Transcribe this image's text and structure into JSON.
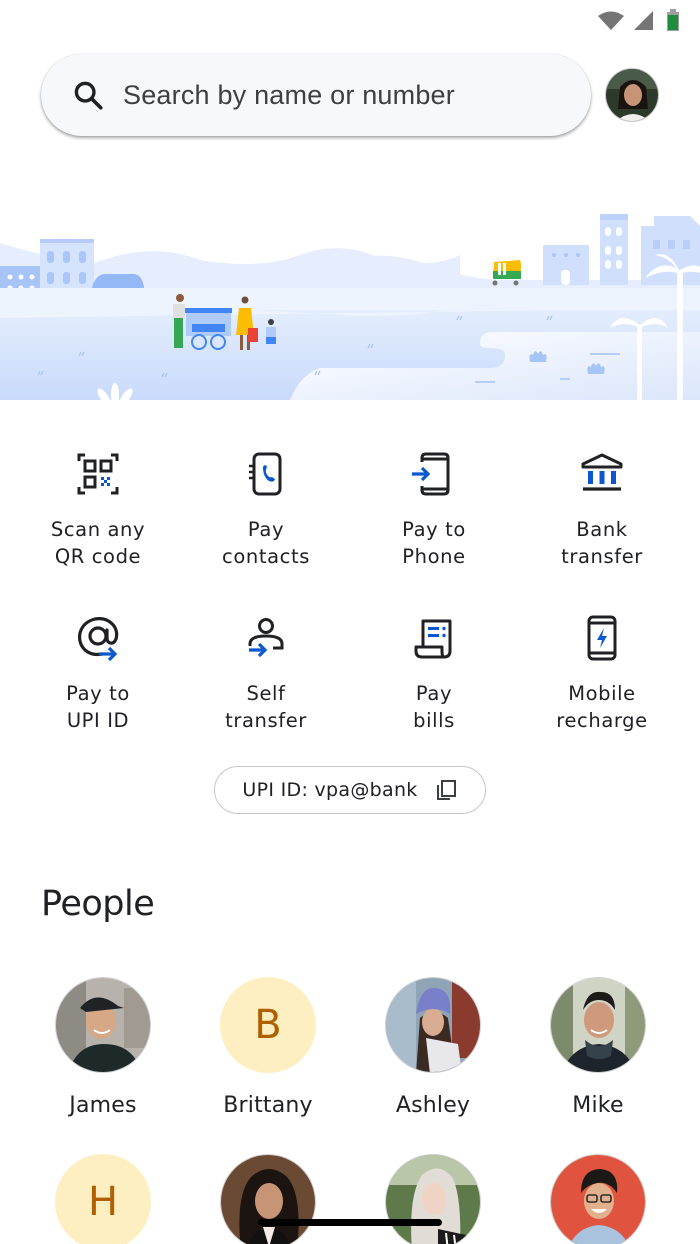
{
  "status_bar": {
    "icons": [
      "wifi-icon",
      "cell-signal-icon",
      "battery-icon"
    ],
    "battery_color": "#1e8e3e"
  },
  "search": {
    "placeholder": "Search by name or number",
    "icon": "search-icon"
  },
  "account": {
    "avatar": "profile-photo"
  },
  "hero": {
    "illustration": "city-street-scene-banner"
  },
  "actions": [
    {
      "label": "Scan any\nQR code",
      "icon": "qr-scan-icon"
    },
    {
      "label": "Pay\ncontacts",
      "icon": "contacts-book-icon"
    },
    {
      "label": "Pay to\nPhone",
      "icon": "phone-arrow-icon"
    },
    {
      "label": "Bank\ntransfer",
      "icon": "bank-icon"
    },
    {
      "label": "Pay to\nUPI ID",
      "icon": "at-arrow-icon"
    },
    {
      "label": "Self\ntransfer",
      "icon": "self-transfer-icon"
    },
    {
      "label": "Pay\nbills",
      "icon": "bill-receipt-icon"
    },
    {
      "label": "Mobile\nrecharge",
      "icon": "mobile-recharge-icon"
    }
  ],
  "upi": {
    "label": "UPI ID: vpa@bank",
    "icon": "copy-icon"
  },
  "people": {
    "title": "People",
    "items": [
      {
        "name": "James",
        "initial": "",
        "type": "photo"
      },
      {
        "name": "Brittany",
        "initial": "B",
        "type": "letter"
      },
      {
        "name": "Ashley",
        "initial": "",
        "type": "photo"
      },
      {
        "name": "Mike",
        "initial": "",
        "type": "photo"
      },
      {
        "name": "",
        "initial": "H",
        "type": "letter"
      },
      {
        "name": "",
        "initial": "",
        "type": "photo"
      },
      {
        "name": "",
        "initial": "",
        "type": "photo"
      },
      {
        "name": "",
        "initial": "",
        "type": "photo"
      }
    ]
  },
  "colors": {
    "accent_blue": "#0b57d0",
    "letter_avatar_bg": "#feefc3",
    "letter_avatar_fg": "#b06000",
    "search_bg": "#f6f8fc"
  }
}
